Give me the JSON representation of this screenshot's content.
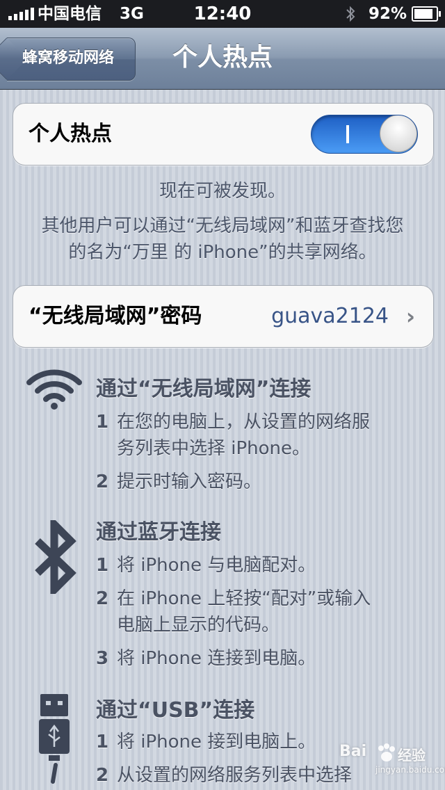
{
  "status_bar": {
    "carrier": "中国电信",
    "network": "3G",
    "time": "12:40",
    "battery_percent": "92%",
    "battery_level": 0.92,
    "signal_bars": 5
  },
  "nav": {
    "back_label": "蜂窝移动网络",
    "title": "个人热点"
  },
  "hotspot": {
    "label": "个人热点",
    "toggle_on": true,
    "toggle_on_color": "#2f7be6"
  },
  "discovery": {
    "line1": "现在可被发现。",
    "line2": "其他用户可以通过“无线局域网”和蓝牙查找您",
    "line3": "的名为“万里 的 iPhone”的共享网络。"
  },
  "password": {
    "label": "“无线局域网”密码",
    "value": "guava2124"
  },
  "sections": {
    "wifi": {
      "title": "通过“无线局域网”连接",
      "step1_num": "1",
      "step1_line1": "在您的电脑上，从设置的网络服",
      "step1_line2": "务列表中选择 iPhone。",
      "step2_num": "2",
      "step2_text": "提示时输入密码。"
    },
    "bluetooth": {
      "title": "通过蓝牙连接",
      "step1_num": "1",
      "step1_text": "将 iPhone 与电脑配对。",
      "step2_num": "2",
      "step2_line1": "在 iPhone 上轻按“配对”或输入",
      "step2_line2": "电脑上显示的代码。",
      "step3_num": "3",
      "step3_text": "将 iPhone 连接到电脑。"
    },
    "usb": {
      "title": "通过“USB”连接",
      "step1_num": "1",
      "step1_text": "将 iPhone 接到电脑上。",
      "step2_num": "2",
      "step2_text": "从设置的网络服务列表中选择"
    }
  },
  "watermark": {
    "text": "Bai",
    "text2": "经验",
    "sub": "jingyan.baidu.com"
  },
  "icons": [
    "wifi-icon",
    "bluetooth-icon",
    "usb-icon",
    "chevron-right-icon",
    "signal-icon",
    "battery-icon"
  ]
}
